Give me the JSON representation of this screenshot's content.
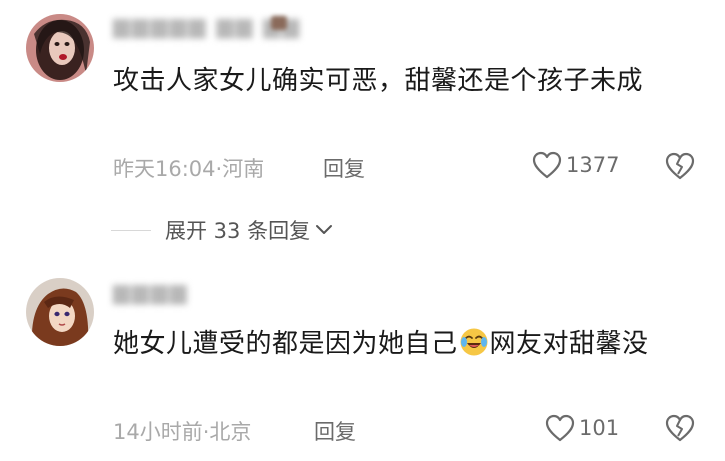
{
  "comments": [
    {
      "text": "攻击人家女儿确实可恶，甜馨还是个孩子未成",
      "time": "昨天16:04",
      "location": "河南",
      "reply_label": "回复",
      "likes": "1377"
    },
    {
      "text_before_emoji": "她女儿遭受的都是因为她自己",
      "emoji": "crying-laughing-emoji",
      "text_after_emoji": "网友对甜馨没",
      "time": "14小时前",
      "location": "北京",
      "reply_label": "回复",
      "likes": "101"
    }
  ],
  "expand_replies": {
    "label": "展开 33 条回复"
  },
  "separator": "·",
  "colors": {
    "text_main": "#1a1a1a",
    "text_meta": "#a9a9a9",
    "text_action": "#6b6b6b"
  }
}
